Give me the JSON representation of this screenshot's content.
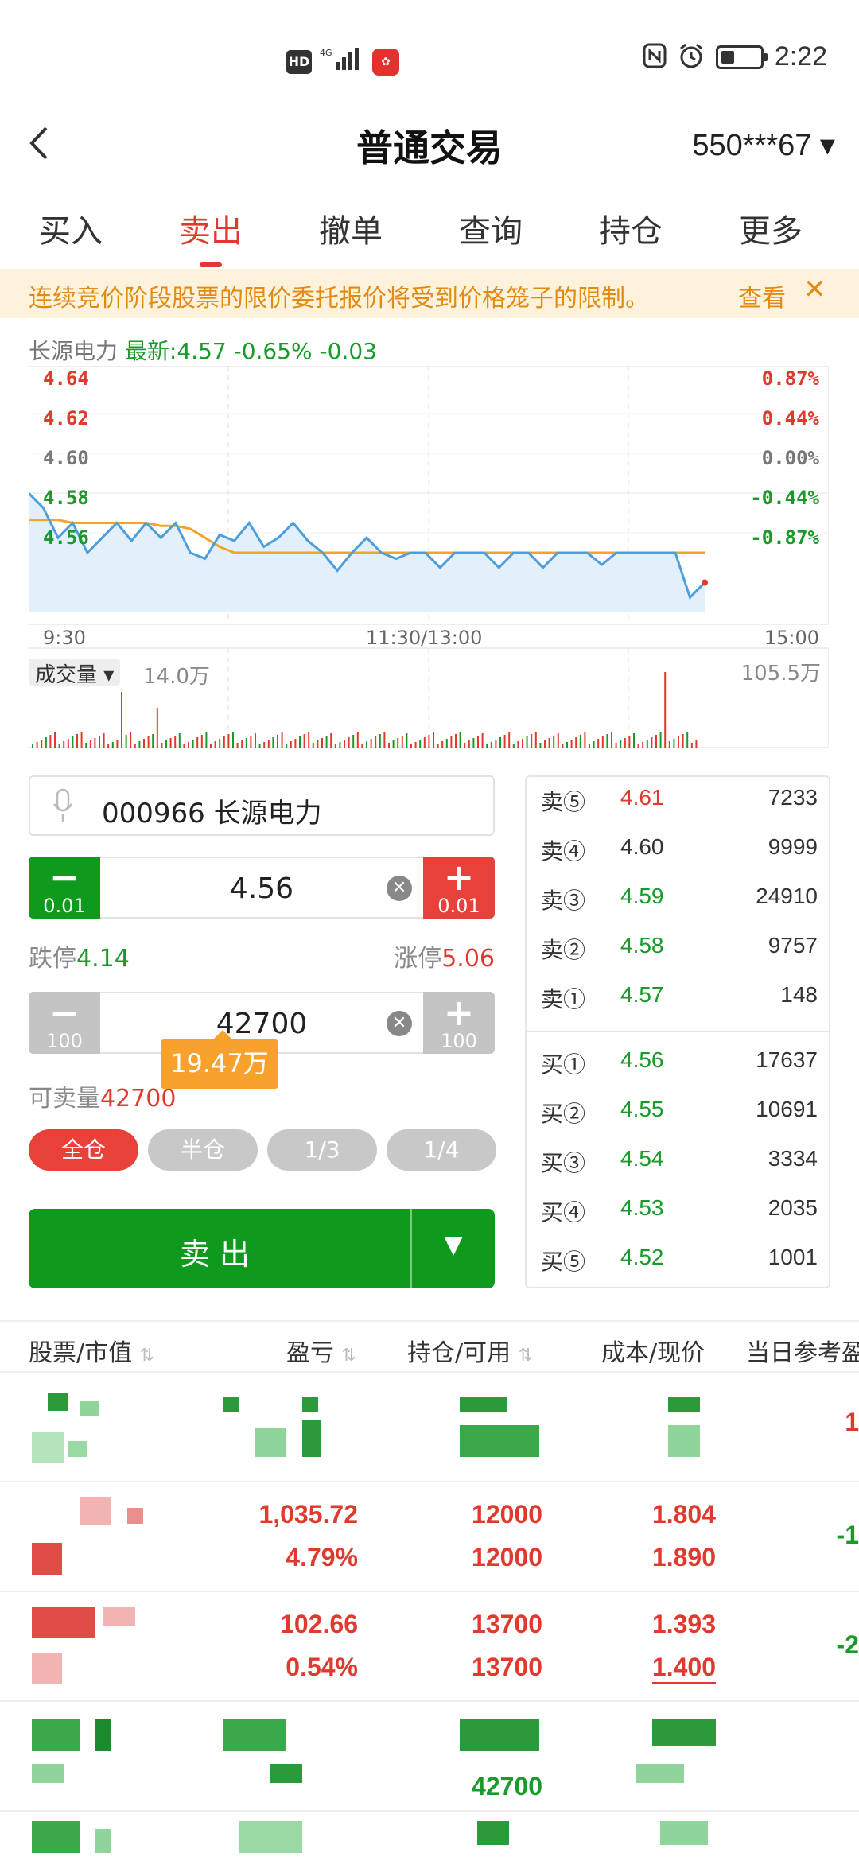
{
  "status_bar": {
    "hd": "HD",
    "network": "4G",
    "time": "2:22"
  },
  "header": {
    "title": "普通交易",
    "account": "550***67 ▾"
  },
  "tabs": [
    "买入",
    "卖出",
    "撤单",
    "查询",
    "持仓",
    "更多"
  ],
  "active_tab": 1,
  "notice": {
    "text": "连续竞价阶段股票的限价委托报价将受到价格笼子的限制。",
    "link": "查看",
    "close": "✕"
  },
  "quote": {
    "name": "长源电力",
    "latest": "最新:4.57 -0.65% -0.03"
  },
  "chart_data": {
    "type": "line",
    "y_left_ticks": [
      "4.64",
      "4.62",
      "4.60",
      "4.58",
      "4.56"
    ],
    "y_right_ticks": [
      "0.87%",
      "0.44%",
      "0.00%",
      "-0.44%",
      "-0.87%"
    ],
    "x_ticks": [
      "9:30",
      "11:30/13:00",
      "15:00"
    ],
    "ylim": [
      4.56,
      4.64
    ],
    "series": [
      {
        "values": [
          4.6,
          4.595,
          4.585,
          4.59,
          4.58,
          4.585,
          4.59,
          4.584,
          4.59,
          4.585,
          4.59,
          4.58,
          4.578,
          4.586,
          4.584,
          4.59,
          4.582,
          4.585,
          4.59,
          4.584,
          4.58,
          4.574,
          4.58,
          4.585,
          4.58,
          4.578,
          4.58,
          4.58,
          4.575,
          4.58,
          4.58,
          4.58,
          4.575,
          4.58,
          4.58,
          4.575,
          4.58,
          4.58,
          4.58,
          4.576,
          4.58,
          4.58,
          4.58,
          4.58,
          4.58,
          4.565,
          4.57
        ]
      },
      {
        "values": [
          4.591,
          4.591,
          4.591,
          4.59,
          4.59,
          4.59,
          4.59,
          4.59,
          4.59,
          4.589,
          4.589,
          4.588,
          4.585,
          4.582,
          4.58,
          4.58,
          4.58,
          4.58,
          4.58,
          4.58,
          4.58,
          4.58,
          4.58,
          4.58,
          4.58,
          4.58,
          4.58,
          4.58,
          4.58,
          4.58,
          4.58,
          4.58,
          4.58,
          4.58,
          4.58,
          4.58,
          4.58,
          4.58,
          4.58,
          4.58,
          4.58,
          4.58,
          4.58,
          4.58,
          4.58,
          4.58,
          4.58
        ]
      }
    ],
    "volume_label": "成交量",
    "volume_current": "14.0万",
    "volume_max": "105.5万"
  },
  "form": {
    "stock": "000966 长源电力",
    "price": "4.56",
    "price_step_minus": "0.01",
    "price_step_plus": "0.01",
    "limit_down_label": "跌停",
    "limit_down": "4.14",
    "limit_up_label": "涨停",
    "limit_up": "5.06",
    "qty": "42700",
    "qty_step_minus": "100",
    "qty_step_plus": "100",
    "amount": "19.47万",
    "avail_label": "可卖量",
    "avail": "42700",
    "ratios": [
      "全仓",
      "半仓",
      "1/3",
      "1/4"
    ],
    "sell_label": "卖出",
    "dropdown": "▼"
  },
  "order_book": {
    "asks": [
      {
        "side": "卖⑤",
        "price": "4.61",
        "vol": "7233",
        "color": "#e03a2f"
      },
      {
        "side": "卖④",
        "price": "4.60",
        "vol": "9999",
        "color": "#333333"
      },
      {
        "side": "卖③",
        "price": "4.59",
        "vol": "24910",
        "color": "#1a9a2a"
      },
      {
        "side": "卖②",
        "price": "4.58",
        "vol": "9757",
        "color": "#1a9a2a"
      },
      {
        "side": "卖①",
        "price": "4.57",
        "vol": "148",
        "color": "#1a9a2a"
      }
    ],
    "bids": [
      {
        "side": "买①",
        "price": "4.56",
        "vol": "17637",
        "color": "#1a9a2a"
      },
      {
        "side": "买②",
        "price": "4.55",
        "vol": "10691",
        "color": "#1a9a2a"
      },
      {
        "side": "买③",
        "price": "4.54",
        "vol": "3334",
        "color": "#1a9a2a"
      },
      {
        "side": "买④",
        "price": "4.53",
        "vol": "2035",
        "color": "#1a9a2a"
      },
      {
        "side": "买⑤",
        "price": "4.52",
        "vol": "1001",
        "color": "#1a9a2a"
      }
    ]
  },
  "holdings": {
    "columns": [
      "股票/市值",
      "盈亏",
      "持仓/可用",
      "成本/现价",
      "当日参考盈"
    ],
    "rows": [
      {
        "pnl": "",
        "pnl_pct": "",
        "hold": "",
        "avail": "",
        "cost": "",
        "price": "",
        "today": "1"
      },
      {
        "pnl": "1,035.72",
        "pnl_pct": "4.79%",
        "hold": "12000",
        "avail": "12000",
        "cost": "1.804",
        "price": "1.890",
        "today": "-1"
      },
      {
        "pnl": "102.66",
        "pnl_pct": "0.54%",
        "hold": "13700",
        "avail": "13700",
        "cost": "1.393",
        "price": "1.400",
        "today": "-2"
      },
      {
        "pnl": "",
        "pnl_pct": "",
        "hold": "",
        "avail": "42700",
        "cost": "",
        "price": "",
        "today": ""
      }
    ]
  }
}
